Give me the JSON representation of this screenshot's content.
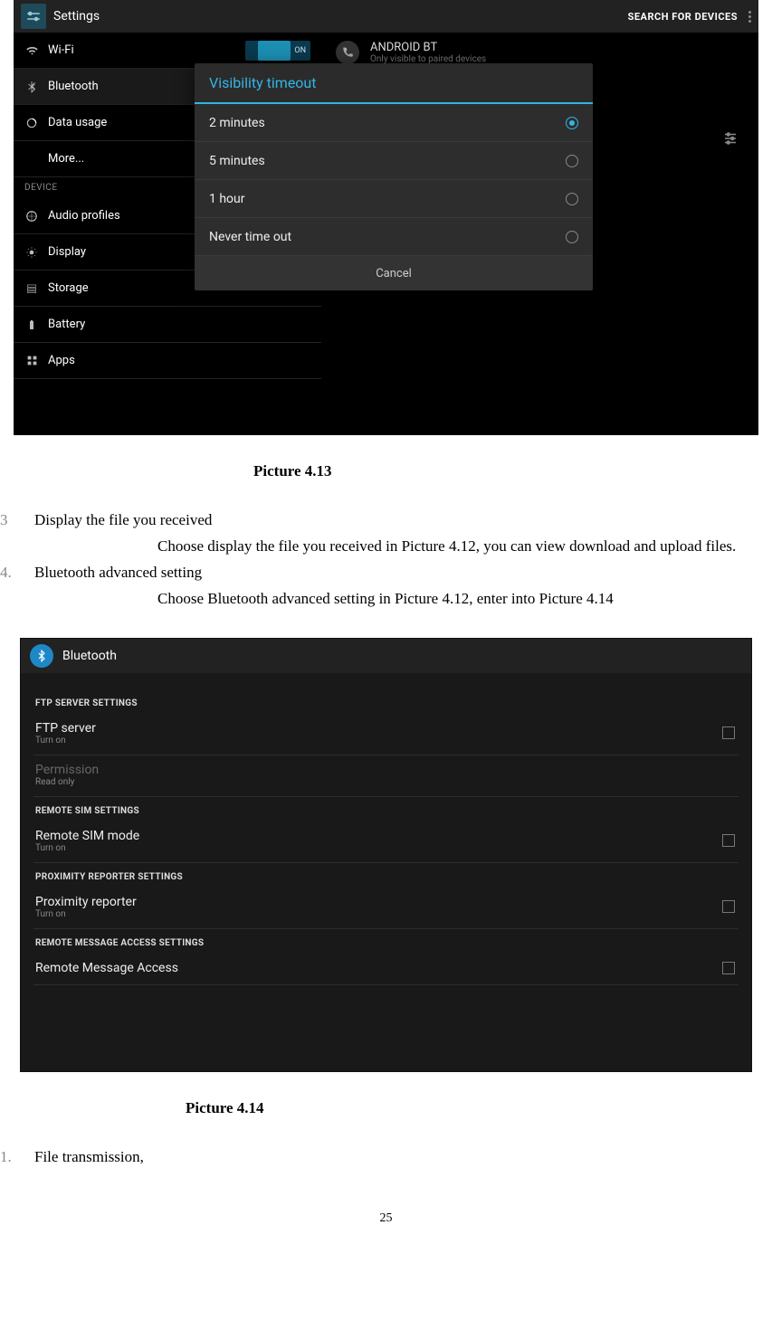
{
  "shot1": {
    "actionbar": {
      "title": "Settings",
      "search_label": "SEARCH FOR DEVICES"
    },
    "sidebar": {
      "items": [
        {
          "label": "Wi-Fi",
          "icon": "wifi",
          "toggle": "ON"
        },
        {
          "label": "Bluetooth",
          "icon": "bluetooth",
          "selected": true
        },
        {
          "label": "Data usage",
          "icon": "data"
        },
        {
          "label": "More...",
          "icon": ""
        }
      ],
      "device_header": "DEVICE",
      "device_items": [
        {
          "label": "Audio profiles",
          "icon": "audio"
        },
        {
          "label": "Display",
          "icon": "display"
        },
        {
          "label": "Storage",
          "icon": "storage"
        },
        {
          "label": "Battery",
          "icon": "battery"
        },
        {
          "label": "Apps",
          "icon": "apps"
        }
      ]
    },
    "main": {
      "device_name": "ANDROID BT",
      "device_sub": "Only visible to paired devices"
    },
    "dialog": {
      "title": "Visibility timeout",
      "options": [
        {
          "label": "2 minutes",
          "selected": true
        },
        {
          "label": "5 minutes",
          "selected": false
        },
        {
          "label": "1 hour",
          "selected": false
        },
        {
          "label": "Never time out",
          "selected": false
        }
      ],
      "cancel_label": "Cancel"
    }
  },
  "caption1": "Picture 4.13",
  "doc_items": [
    {
      "num": "3",
      "title": "Display the file you received",
      "body": "Choose display the file you received in Picture 4.12, you can view download and upload files."
    },
    {
      "num": "4.",
      "title": "Bluetooth advanced setting",
      "body": "Choose Bluetooth advanced setting in Picture 4.12, enter into Picture 4.14"
    }
  ],
  "shot2": {
    "header": "Bluetooth",
    "groups": [
      {
        "title": "FTP SERVER SETTINGS",
        "rows": [
          {
            "t1": "FTP server",
            "t2": "Turn on",
            "cb": true
          },
          {
            "t1": "Permission",
            "t2": "Read only",
            "cb": false,
            "disabled": true
          }
        ]
      },
      {
        "title": "REMOTE SIM SETTINGS",
        "rows": [
          {
            "t1": "Remote SIM mode",
            "t2": "Turn on",
            "cb": true
          }
        ]
      },
      {
        "title": "PROXIMITY REPORTER SETTINGS",
        "rows": [
          {
            "t1": "Proximity reporter",
            "t2": "Turn on",
            "cb": true
          }
        ]
      },
      {
        "title": "REMOTE MESSAGE ACCESS SETTINGS",
        "rows": [
          {
            "t1": "Remote Message Access",
            "t2": "",
            "cb": true
          }
        ]
      }
    ]
  },
  "caption2": "Picture 4.14",
  "tail_item": {
    "num": "1.",
    "title": "File transmission,"
  },
  "page_number": "25"
}
